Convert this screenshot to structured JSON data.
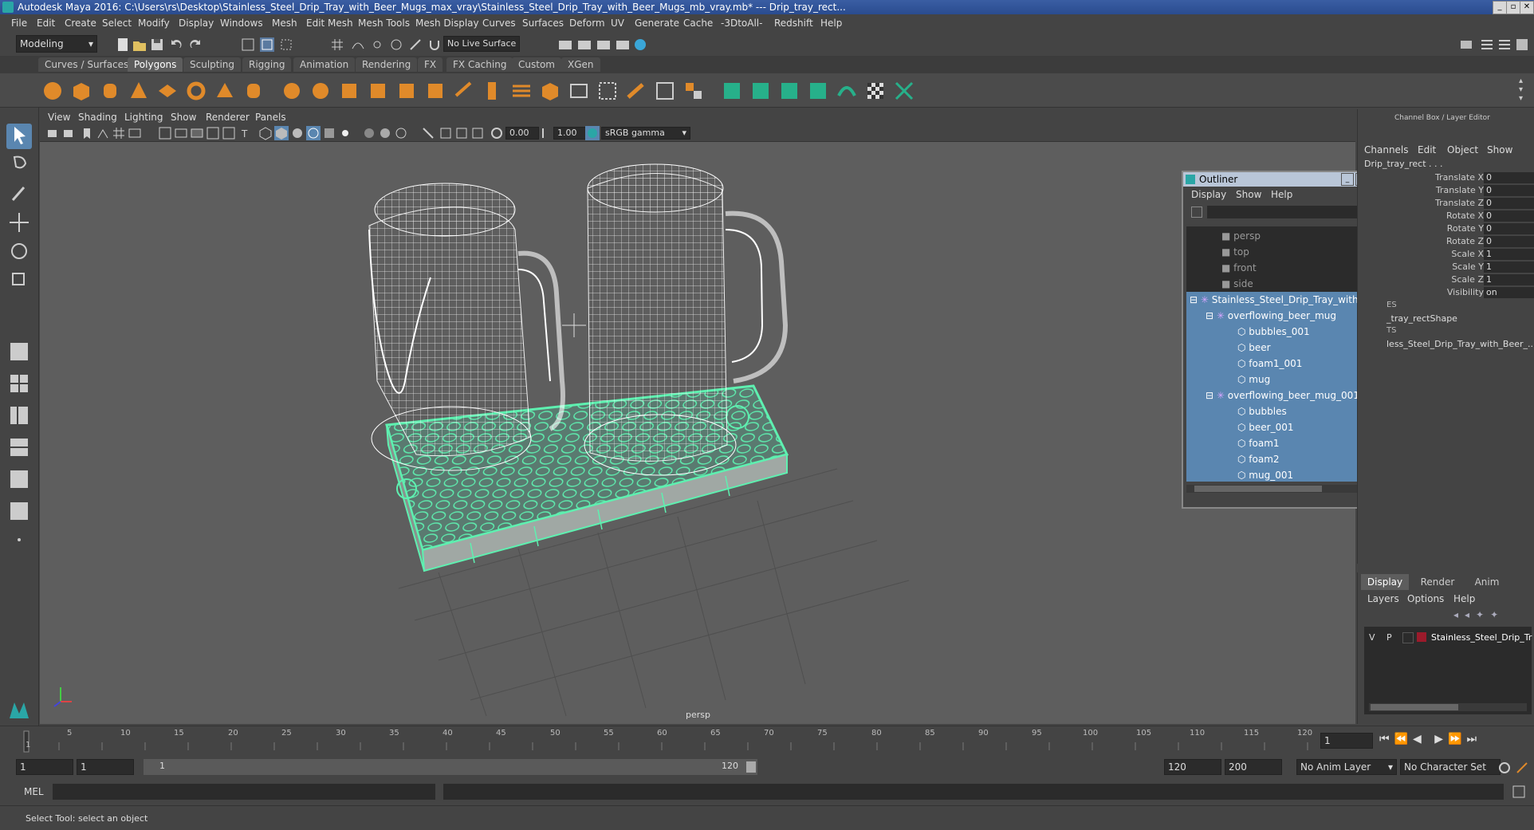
{
  "window": {
    "title": "Autodesk Maya 2016: C:\\Users\\rs\\Desktop\\Stainless_Steel_Drip_Tray_with_Beer_Mugs_max_vray\\Stainless_Steel_Drip_Tray_with_Beer_Mugs_mb_vray.mb*  ---  Drip_tray_rect..."
  },
  "menubar": [
    "File",
    "Edit",
    "Create",
    "Select",
    "Modify",
    "Display",
    "Windows",
    "Mesh",
    "Edit Mesh",
    "Mesh Tools",
    "Mesh Display",
    "Curves",
    "Surfaces",
    "Deform",
    "UV",
    "Generate",
    "Cache",
    "-3DtoAll-",
    "Redshift",
    "Help"
  ],
  "statusline": {
    "mode": "Modeling",
    "live_surface": "No Live Surface"
  },
  "shelf_tabs": [
    "Curves / Surfaces",
    "Polygons",
    "Sculpting",
    "Rigging",
    "Animation",
    "Rendering",
    "FX",
    "FX Caching",
    "Custom",
    "XGen"
  ],
  "active_shelf_tab": "Polygons",
  "viewport": {
    "menu": [
      "View",
      "Shading",
      "Lighting",
      "Show",
      "Renderer",
      "Panels"
    ],
    "exposure": "0.00",
    "gamma": "1.00",
    "color_space": "sRGB gamma",
    "camera_label": "persp"
  },
  "outliner": {
    "title": "Outliner",
    "menu": [
      "Display",
      "Show",
      "Help"
    ],
    "cameras": [
      "persp",
      "top",
      "front",
      "side"
    ],
    "root": "Stainless_Steel_Drip_Tray_with_Be",
    "groups": [
      {
        "name": "overflowing_beer_mug",
        "children": [
          "bubbles_001",
          "beer",
          "foam1_001",
          "mug"
        ]
      },
      {
        "name": "overflowing_beer_mug_001",
        "children": [
          "bubbles",
          "beer_001",
          "foam1",
          "foam2",
          "mug_001"
        ]
      }
    ]
  },
  "channelbox": {
    "header": "Channel Box / Layer Editor",
    "menu": [
      "Channels",
      "Edit",
      "Object",
      "Show"
    ],
    "object": "Drip_tray_rect . . .",
    "channels": [
      {
        "label": "Translate X",
        "value": "0"
      },
      {
        "label": "Translate Y",
        "value": "0"
      },
      {
        "label": "Translate Z",
        "value": "0"
      },
      {
        "label": "Rotate X",
        "value": "0"
      },
      {
        "label": "Rotate Y",
        "value": "0"
      },
      {
        "label": "Rotate Z",
        "value": "0"
      },
      {
        "label": "Scale X",
        "value": "1"
      },
      {
        "label": "Scale Y",
        "value": "1"
      },
      {
        "label": "Scale Z",
        "value": "1"
      },
      {
        "label": "Visibility",
        "value": "on"
      }
    ],
    "shapes_header": "ES",
    "shape": "_tray_rectShape",
    "inputs_header": "TS",
    "input": "less_Steel_Drip_Tray_with_Beer_..."
  },
  "layers": {
    "tabs": [
      "Display",
      "Render",
      "Anim"
    ],
    "menu": [
      "Layers",
      "Options",
      "Help"
    ],
    "layer": {
      "v": "V",
      "p": "P",
      "name": "Stainless_Steel_Drip_Tr",
      "color": "#9b1b2b"
    }
  },
  "timeline": {
    "ticks": [
      "1",
      "5",
      "10",
      "15",
      "20",
      "25",
      "30",
      "35",
      "40",
      "45",
      "50",
      "55",
      "60",
      "65",
      "70",
      "75",
      "80",
      "85",
      "90",
      "95",
      "100",
      "105",
      "110",
      "115",
      "120"
    ],
    "current_frame": "1"
  },
  "range": {
    "start": "1",
    "start2": "1",
    "slider_start": "1",
    "slider_end": "120",
    "end": "120",
    "end2": "200",
    "anim_layer": "No Anim Layer",
    "char_set": "No Character Set"
  },
  "mel": {
    "label": "MEL"
  },
  "help": "Select Tool: select an object",
  "colors": {
    "selection": "#5ef0b0",
    "outliner_sel": "#5a86b0",
    "wire": "#ffffff"
  }
}
